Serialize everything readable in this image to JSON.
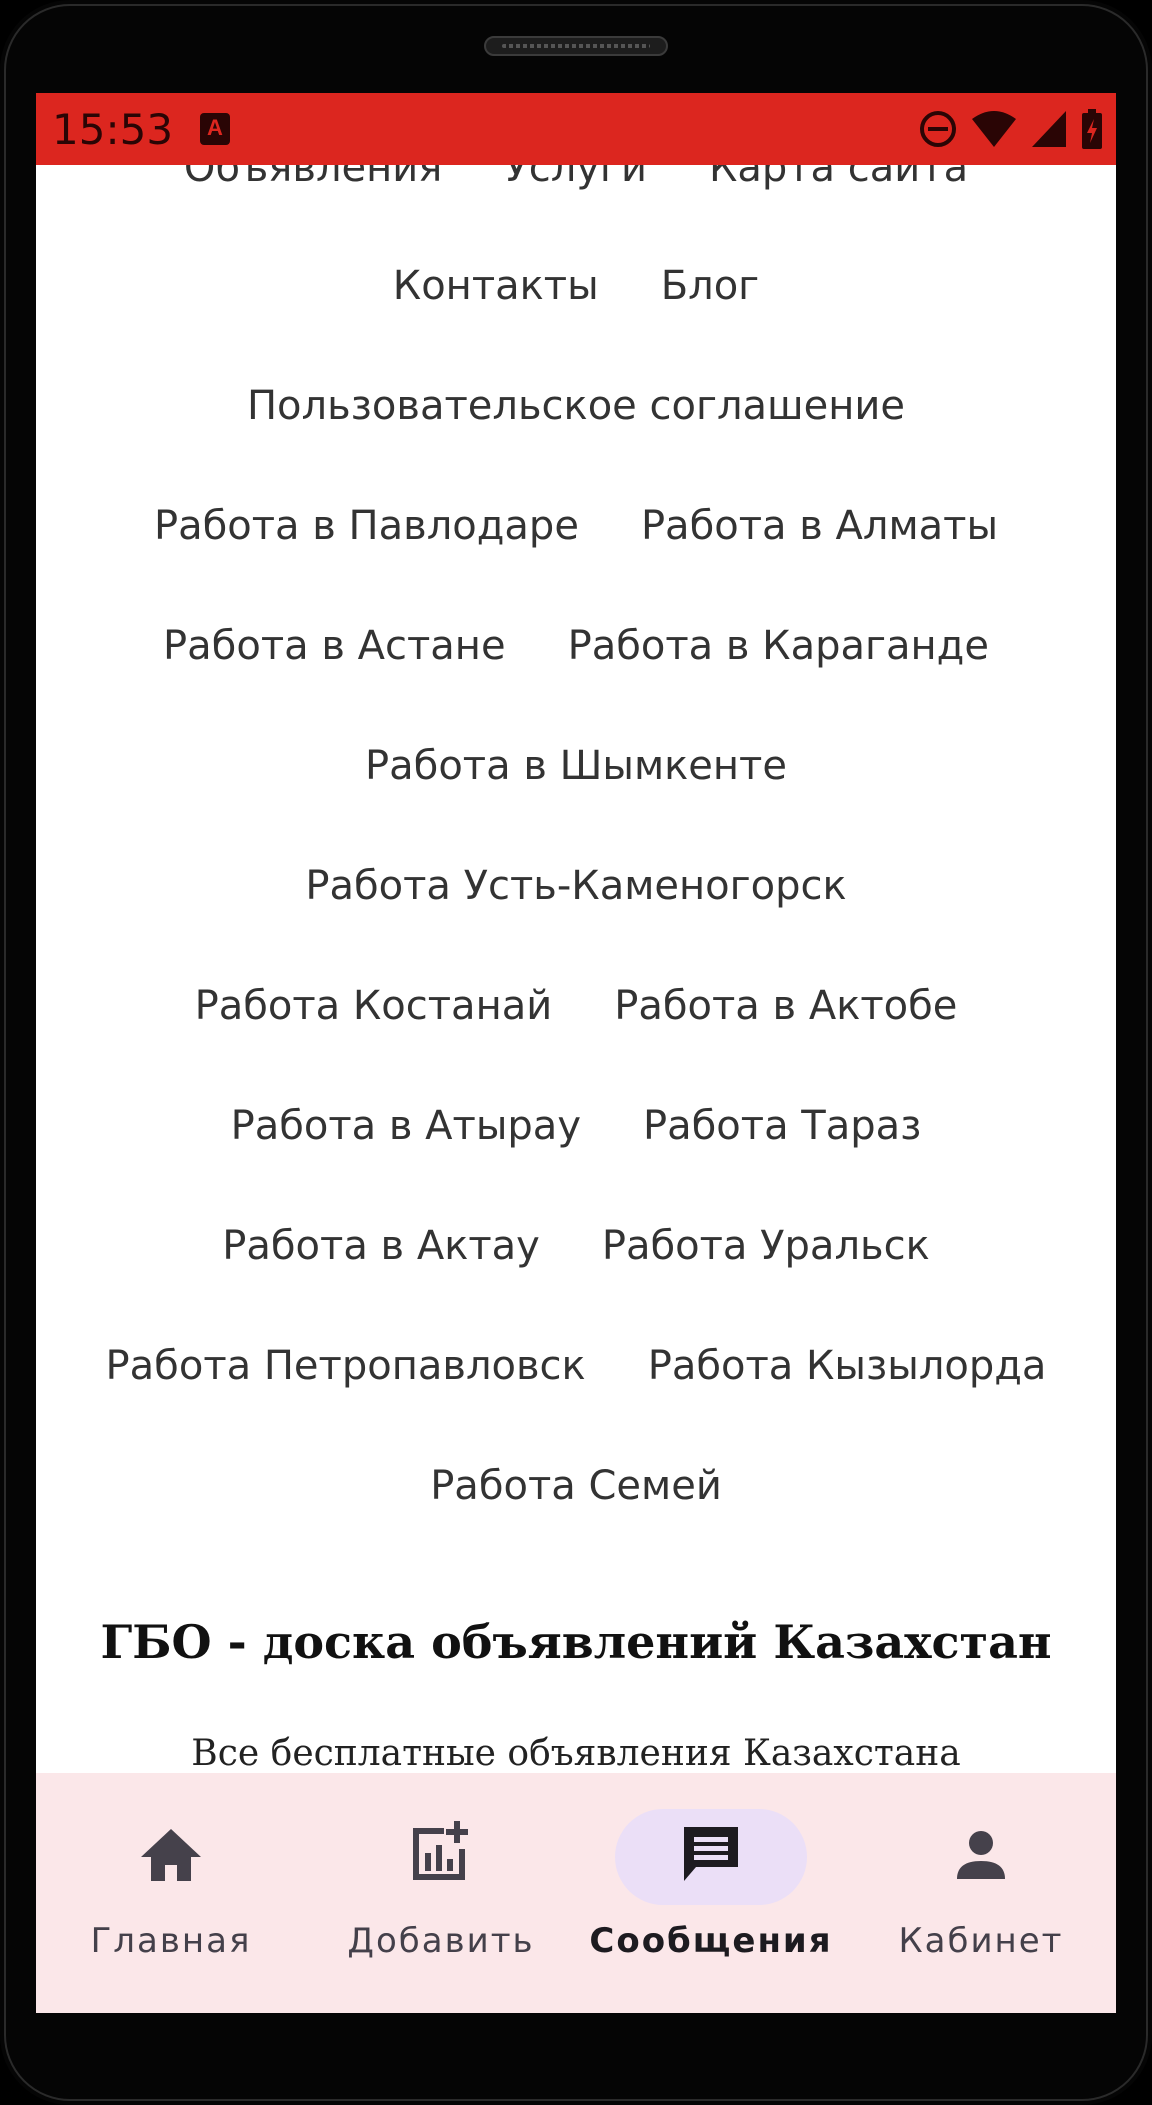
{
  "status_bar": {
    "time": "15:53",
    "app_icon": "A"
  },
  "links": {
    "row0": [
      "Объявления",
      "Услуги",
      "Карта сайта"
    ],
    "row1": [
      "Контакты",
      "Блог"
    ],
    "row2": [
      "Пользовательское соглашение"
    ],
    "row3": [
      "Работа в Павлодаре",
      "Работа в Алматы"
    ],
    "row4": [
      "Работа в Астане",
      "Работа в Караганде"
    ],
    "row5": [
      "Работа в Шымкенте"
    ],
    "row6": [
      "Работа Усть-Каменогорск"
    ],
    "row7": [
      "Работа Костанай",
      "Работа в Актобе"
    ],
    "row8": [
      "Работа в Атырау",
      "Работа Тараз"
    ],
    "row9": [
      "Работа в Актау",
      "Работа Уральск"
    ],
    "row10": [
      "Работа Петропавловск",
      "Работа Кызылорда"
    ],
    "row11": [
      "Работа Семей"
    ]
  },
  "footer": {
    "title": "ГБО - доска объявлений Казахстан",
    "subtitle": "Все бесплатные объявления Казахстана"
  },
  "bottom_nav": {
    "items": [
      {
        "label": "Главная",
        "icon": "home-icon",
        "active": false
      },
      {
        "label": "Добавить",
        "icon": "add-chart-icon",
        "active": false
      },
      {
        "label": "Сообщения",
        "icon": "message-icon",
        "active": true
      },
      {
        "label": "Кабинет",
        "icon": "person-icon",
        "active": false
      }
    ]
  },
  "colors": {
    "status_bar": "#dc261f",
    "nav_background": "#fbe7e9",
    "active_pill": "#ebdff7",
    "link_text": "#333333"
  }
}
